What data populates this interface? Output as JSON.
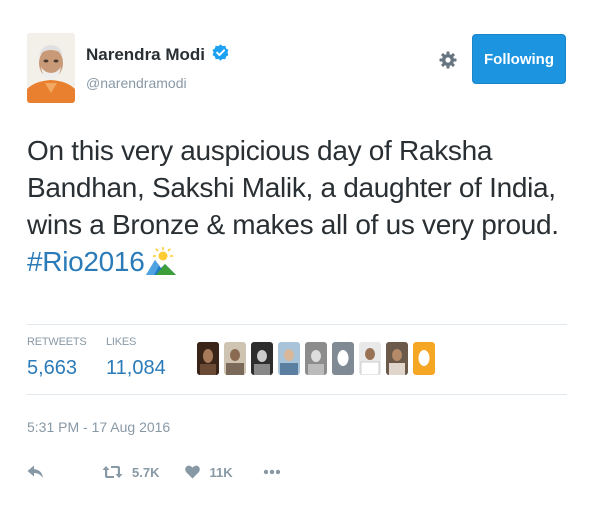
{
  "user": {
    "display_name": "Narendra Modi",
    "handle": "@narendramodi",
    "verified": true
  },
  "follow_button": {
    "label": "Following"
  },
  "tweet": {
    "text": "On this very auspicious day of Raksha Bandhan, Sakshi Malik, a daughter of India, wins a Bronze & makes all of us very proud. ",
    "hashtag": "#Rio2016"
  },
  "stats": {
    "retweets_label": "RETWEETS",
    "retweets_value": "5,663",
    "likes_label": "LIKES",
    "likes_value": "11,084"
  },
  "timestamp": "5:31 PM - 17 Aug 2016",
  "actions": {
    "retweet_count": "5.7K",
    "like_count": "11K"
  },
  "colors": {
    "follow_button": "#1c94e0",
    "link": "#2b7bb9",
    "muted": "#8899a6",
    "text": "#292f33"
  }
}
